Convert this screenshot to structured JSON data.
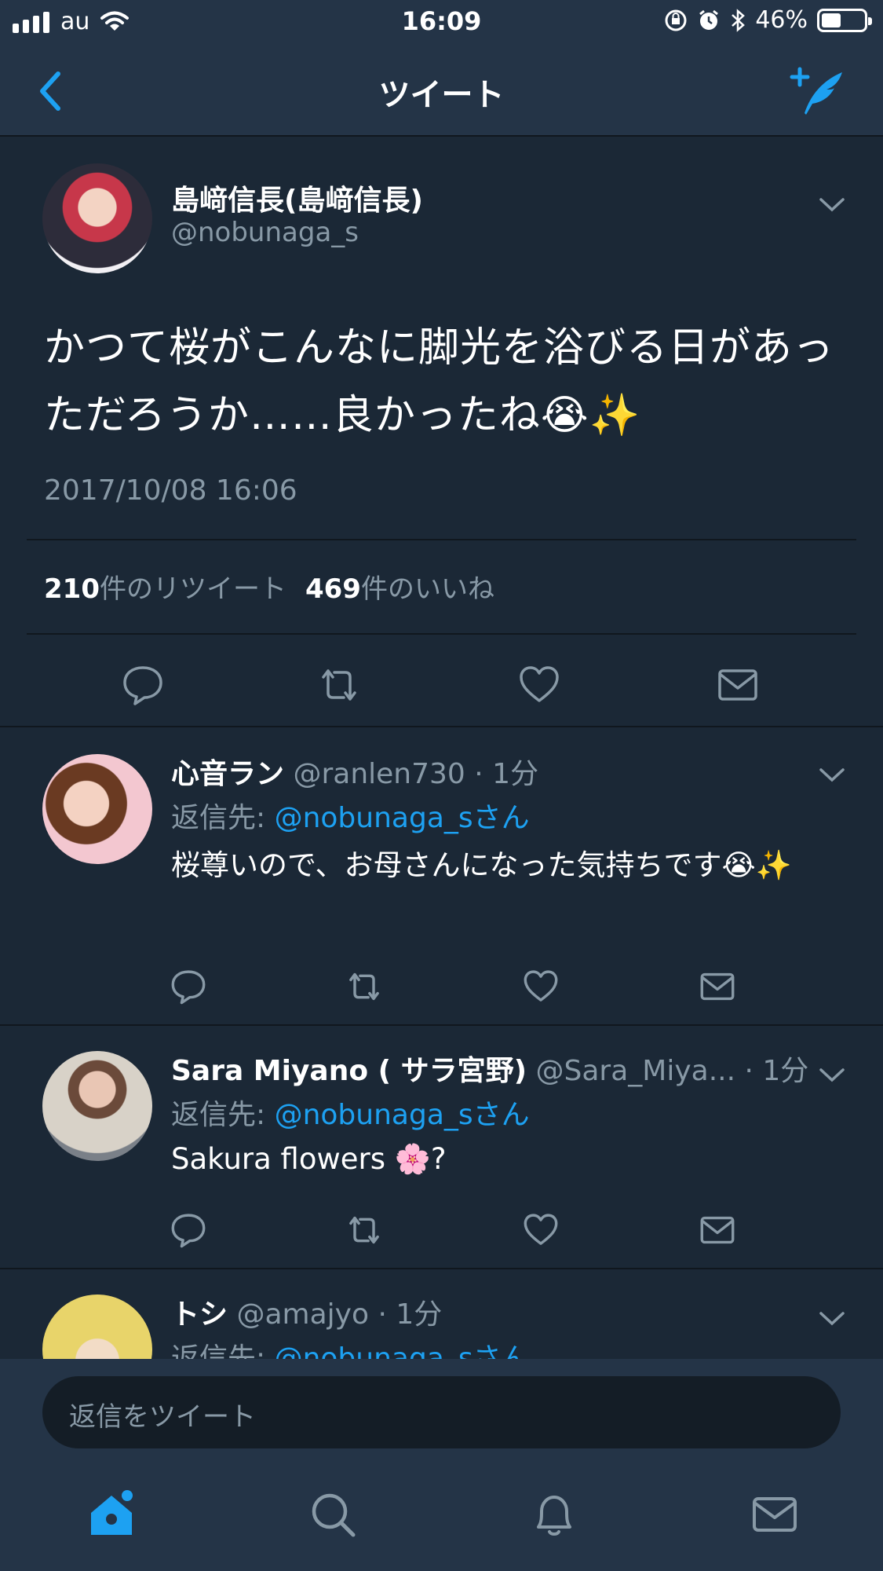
{
  "status_bar": {
    "carrier": "au",
    "time": "16:09",
    "battery_percent": "46%",
    "battery_level": 0.46
  },
  "nav": {
    "title": "ツイート"
  },
  "main_tweet": {
    "display_name": "島﨑信長(島﨑信長)",
    "handle": "@nobunaga_s",
    "text": "かつて桜がこんなに脚光を浴びる日があっただろうか……良かったね😭✨",
    "timestamp": "2017/10/08 16:06",
    "retweet_count": "210",
    "retweet_suffix": "件のリツイート",
    "like_count": "469",
    "like_suffix": "件のいいね"
  },
  "replies": [
    {
      "display_name": "心音ラン",
      "handle": "@ranlen730",
      "time": "· 1分",
      "reply_to_prefix": "返信先: ",
      "reply_to_link": "@nobunaga_sさん",
      "text": "桜尊いので、お母さんになった気持ちです😭✨"
    },
    {
      "display_name": "Sara Miyano ( サラ宮野)",
      "handle": "@Sara_Miya...",
      "time": "· 1分",
      "reply_to_prefix": "返信先: ",
      "reply_to_link": "@nobunaga_sさん",
      "text": "Sakura flowers 🌸?"
    },
    {
      "display_name": "トシ",
      "handle": "@amajyo",
      "time": "· 1分",
      "reply_to_prefix": "返信先: ",
      "reply_to_link": "@nobunaga_sさん",
      "text": ""
    }
  ],
  "reply_bar": {
    "placeholder": "返信をツイート"
  },
  "icons": {
    "back": "chevron-left-icon",
    "compose": "compose-tweet-icon",
    "reply": "reply-icon",
    "retweet": "retweet-icon",
    "like": "heart-icon",
    "dm": "envelope-icon",
    "home": "home-icon",
    "search": "search-icon",
    "notifications": "bell-icon",
    "messages": "messages-icon"
  },
  "colors": {
    "background": "#1b2836",
    "bar": "#243447",
    "accent": "#1da1f2",
    "secondary_text": "#8899a6"
  }
}
